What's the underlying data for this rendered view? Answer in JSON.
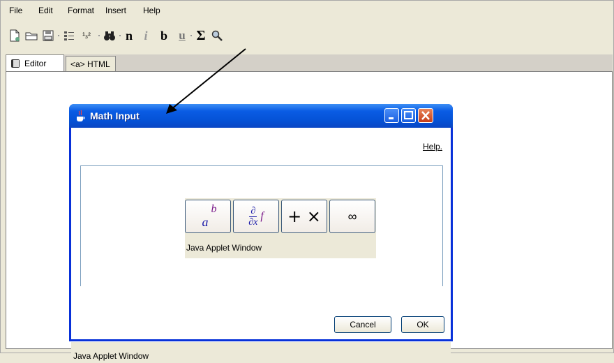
{
  "menu": {
    "items": [
      "File",
      "Edit",
      "Format",
      "Insert",
      "Help"
    ]
  },
  "toolbar": {
    "fraction_label": "¹₃²",
    "bold_label": "n",
    "italic_label": "i",
    "b_label": "b",
    "underline_label": "u",
    "sigma_label": "Σ"
  },
  "tabs": [
    {
      "label": "Editor",
      "active": true
    },
    {
      "label": "<a> HTML",
      "active": false
    }
  ],
  "dialog": {
    "title": "Math Input",
    "help_label": "Help.",
    "math_buttons": {
      "superscript": {
        "base": "a",
        "exp": "b"
      },
      "derivative": {
        "num": "∂",
        "den": "∂x",
        "fn": "f"
      },
      "operators": "+ ×",
      "infinity": "∞"
    },
    "applet_caption": "Java Applet Window",
    "cancel_label": "Cancel",
    "ok_label": "OK",
    "bottom_caption": "Java Applet Window"
  },
  "colors": {
    "titlebar": "#0a5ce4",
    "close_button": "#c63d18",
    "math_blue": "#1a1aa8",
    "math_purple": "#7a1a8a"
  }
}
